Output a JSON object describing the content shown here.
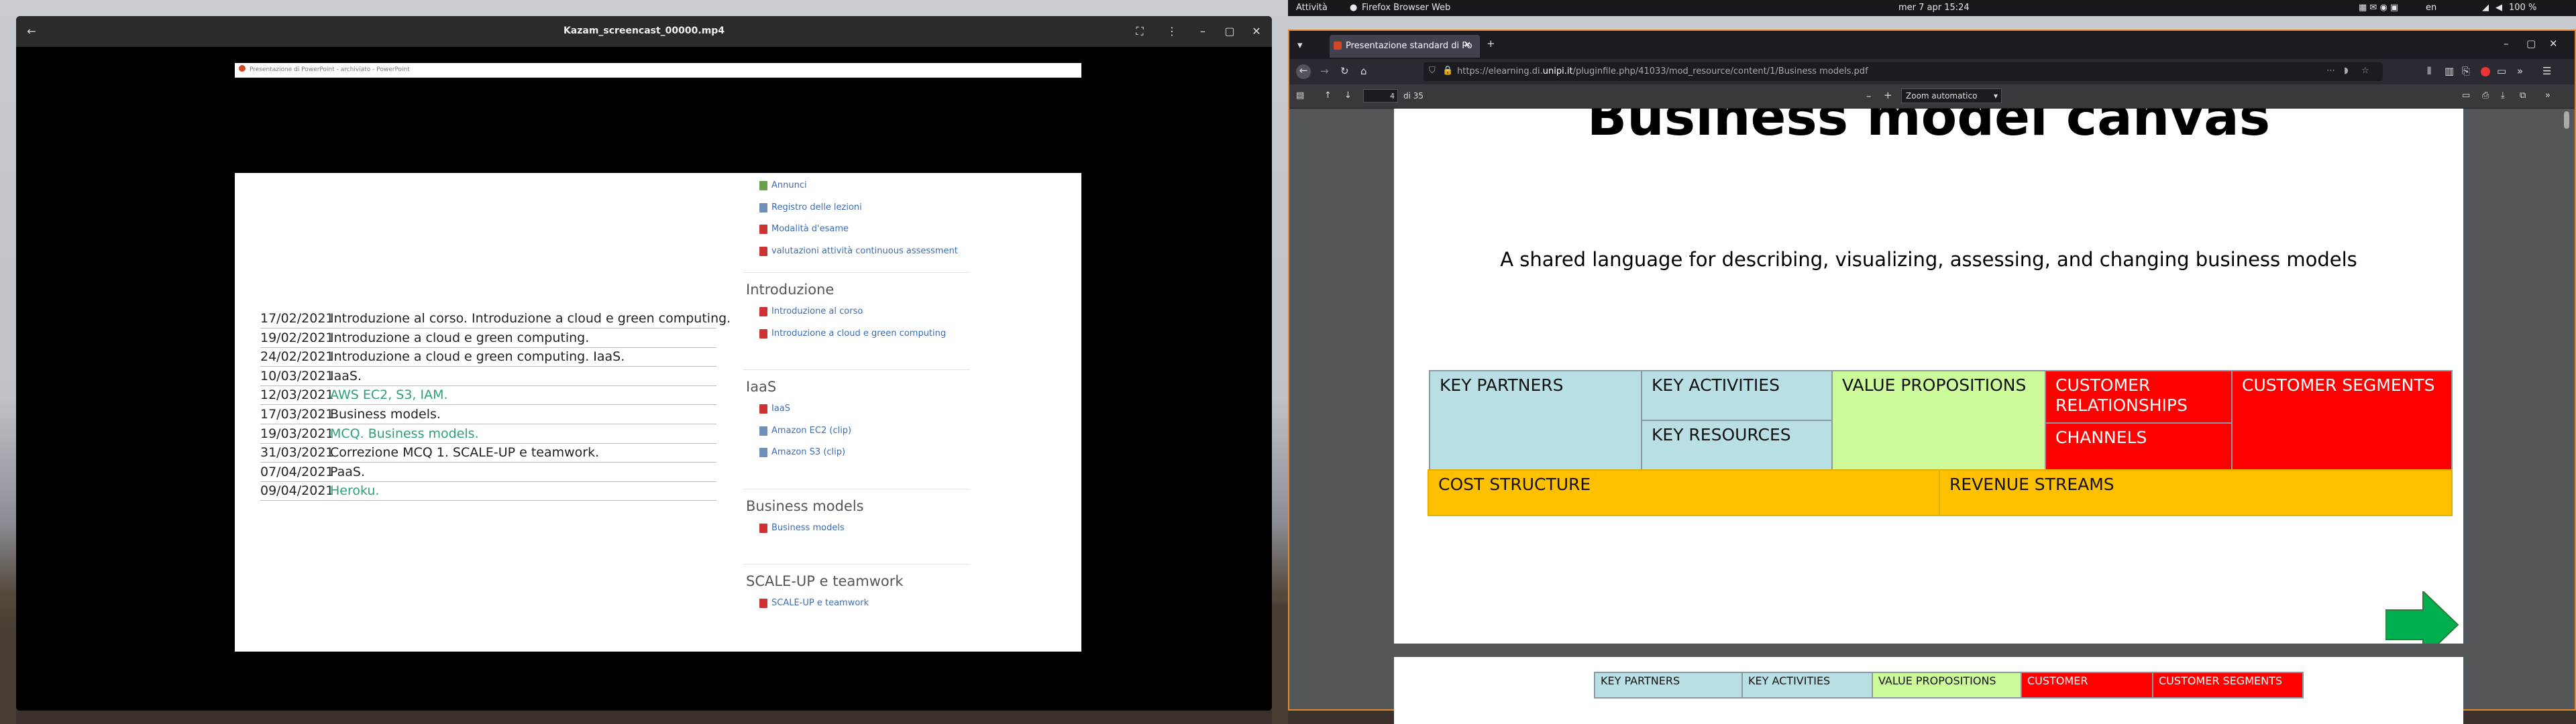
{
  "system_bar": {
    "activities": "Attività",
    "app_name": "Firefox Browser Web",
    "clock": "mer 7 apr  15:24",
    "lang": "en",
    "battery": "100 %"
  },
  "video_window": {
    "title": "Kazam_screencast_00000.mp4",
    "inner_tab_text": "Presentazione di PowerPoint - archiviato - PowerPoint",
    "schedule": [
      {
        "date": "17/02/2021",
        "text": "Introduzione al corso. Introduzione a cloud e green computing.",
        "link": false
      },
      {
        "date": "19/02/2021",
        "text": "Introduzione a cloud e green computing.",
        "link": false
      },
      {
        "date": "24/02/2021",
        "text": "Introduzione a cloud e green computing. IaaS.",
        "link": false
      },
      {
        "date": "10/03/2021",
        "text": "IaaS.",
        "link": false
      },
      {
        "date": "12/03/2021",
        "text": "AWS EC2, S3, IAM.",
        "link": true
      },
      {
        "date": "17/03/2021",
        "text": "Business models.",
        "link": false
      },
      {
        "date": "19/03/2021",
        "text": "MCQ. Business models.",
        "link": true
      },
      {
        "date": "31/03/2021",
        "text": "Correzione MCQ 1. SCALE-UP e teamwork.",
        "link": false
      },
      {
        "date": "07/04/2021",
        "text": "PaaS.",
        "link": false
      },
      {
        "date": "09/04/2021",
        "text": "Heroku.",
        "link": true
      }
    ],
    "top_links": [
      "Annunci",
      "Registro delle lezioni",
      "Modalità d'esame",
      "valutazioni attività continuous assessment"
    ],
    "sections": [
      {
        "title": "Introduzione",
        "links": [
          "Introduzione al corso",
          "Introduzione a cloud e green computing"
        ]
      },
      {
        "title": "IaaS",
        "links": [
          "IaaS",
          "Amazon EC2 (clip)",
          "Amazon S3 (clip)"
        ]
      },
      {
        "title": "Business models",
        "links": [
          "Business models"
        ]
      },
      {
        "title": "SCALE-UP e teamwork",
        "links": [
          "SCALE-UP e teamwork"
        ]
      }
    ]
  },
  "firefox": {
    "tab_title": "Presentazione standard di Po",
    "url_prefix": "https://elearning.di.",
    "url_domain": "unipi.it",
    "url_path": "/pluginfile.php/41033/mod_resource/content/1/Business models.pdf",
    "page_number": "4",
    "page_total": "di 35",
    "zoom": "Zoom automatico",
    "slide_title": "Business model canvas",
    "slide_subtitle": "A shared language for describing, visualizing, assessing, and changing business models",
    "canvas": {
      "key_partners": "KEY PARTNERS",
      "key_activities": "KEY ACTIVITIES",
      "key_resources": "KEY RESOURCES",
      "value_propositions": "VALUE PROPOSITIONS",
      "customer_relationships": "CUSTOMER RELATIONSHIPS",
      "channels": "CHANNELS",
      "customer_segments": "CUSTOMER SEGMENTS",
      "cost_structure": "COST STRUCTURE",
      "revenue_streams": "REVENUE STREAMS"
    },
    "next_slide_canvas": {
      "key_partners": "KEY PARTNERS",
      "key_activities": "KEY ACTIVITIES",
      "value_propositions": "VALUE PROPOSITIONS",
      "customer": "CUSTOMER",
      "customer_segments": "CUSTOMER SEGMENTS"
    }
  },
  "colors": {
    "canvas_blue": "#b8dfe3",
    "canvas_lime": "#ccf99a",
    "canvas_red": "#ff0000",
    "canvas_amber": "#ffc000",
    "arrow_green": "#00b050",
    "focus_orange": "#e08a2c"
  }
}
